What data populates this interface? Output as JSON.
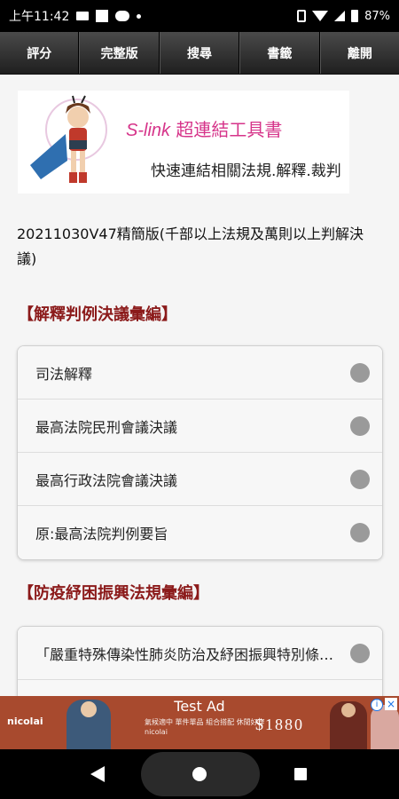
{
  "status_bar": {
    "time": "上午11:42",
    "battery": "87%"
  },
  "tabs": [
    {
      "label": "評分"
    },
    {
      "label": "完整版"
    },
    {
      "label": "搜尋"
    },
    {
      "label": "書籤"
    },
    {
      "label": "離開"
    }
  ],
  "banner": {
    "title_latin": "S-link",
    "title_cjk": " 超連結工具書",
    "subtitle": "快速連結相關法規.解釋.裁判"
  },
  "version_text": "20211030V47精簡版(千部以上法規及萬則以上判解決議)",
  "sections": [
    {
      "heading": "【解釋判例決議彙編】",
      "items": [
        {
          "label": "司法解釋"
        },
        {
          "label": "最高法院民刑會議決議"
        },
        {
          "label": "最高行政法院會議決議"
        },
        {
          "label": "原:最高法院判例要旨"
        }
      ]
    },
    {
      "heading": "【防疫紓困振興法規彙編】",
      "items": [
        {
          "label": "「嚴重特殊傳染性肺炎防治及紓困振興特別條例」"
        },
        {
          "label": ""
        }
      ]
    }
  ],
  "ad": {
    "title": "Test Ad",
    "brand": "nicolai",
    "copy_line1": "氣候適中 單件單品 組合搭配 休閒好穿",
    "copy_line2": "nicolai",
    "price": "$1880",
    "info": "i",
    "close": "×"
  },
  "colors": {
    "tab_bar": "#2f2f2f",
    "section_heading": "#8b1a1a",
    "banner_title": "#d6348a",
    "ad_background": "#a84a2e"
  }
}
